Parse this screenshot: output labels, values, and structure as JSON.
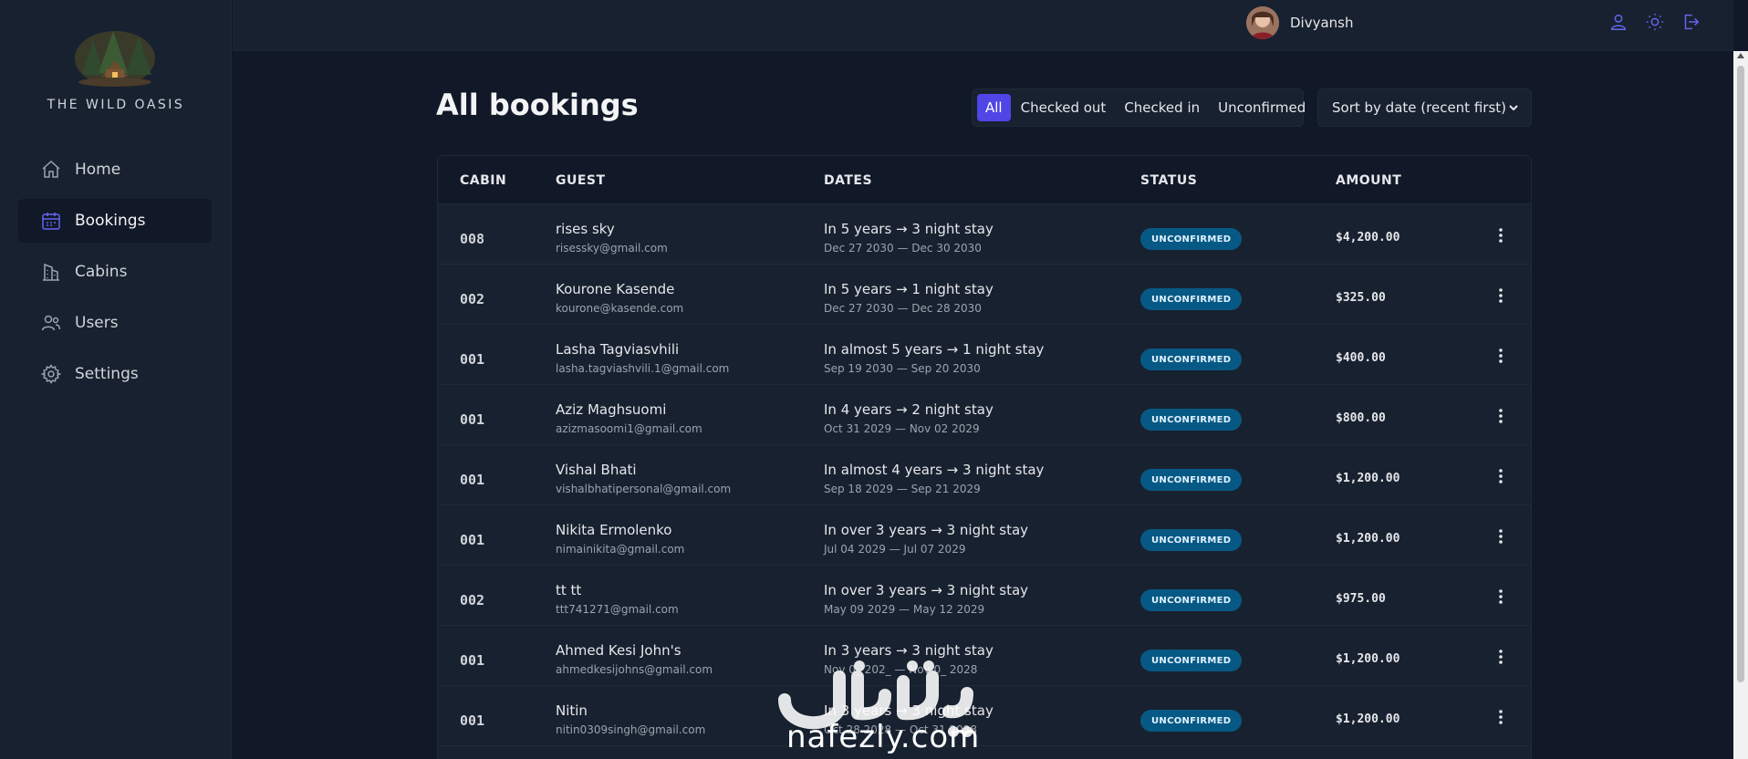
{
  "app": {
    "logo_text": "THE WILD OASIS"
  },
  "sidebar": {
    "items": [
      {
        "label": "Home",
        "icon": "home-icon",
        "active": false
      },
      {
        "label": "Bookings",
        "icon": "calendar-icon",
        "active": true
      },
      {
        "label": "Cabins",
        "icon": "building-icon",
        "active": false
      },
      {
        "label": "Users",
        "icon": "users-icon",
        "active": false
      },
      {
        "label": "Settings",
        "icon": "gear-icon",
        "active": false
      }
    ]
  },
  "header": {
    "username": "Divyansh",
    "icons": [
      "user-icon",
      "sun-icon",
      "logout-icon"
    ]
  },
  "page": {
    "title": "All bookings"
  },
  "filter": {
    "options": [
      "All",
      "Checked out",
      "Checked in",
      "Unconfirmed"
    ],
    "active": "All"
  },
  "sort": {
    "selected": "Sort by date (recent first)"
  },
  "table": {
    "columns": [
      "CABIN",
      "GUEST",
      "DATES",
      "STATUS",
      "AMOUNT"
    ],
    "rows": [
      {
        "cabin": "008",
        "name": "rises sky",
        "email": "risessky@gmail.com",
        "dates": "In 5 years → 3 night stay",
        "range": "Dec 27 2030 — Dec 30 2030",
        "status": "UNCONFIRMED",
        "amount": "$4,200.00"
      },
      {
        "cabin": "002",
        "name": "Kourone Kasende",
        "email": "kourone@kasende.com",
        "dates": "In 5 years → 1 night stay",
        "range": "Dec 27 2030 — Dec 28 2030",
        "status": "UNCONFIRMED",
        "amount": "$325.00"
      },
      {
        "cabin": "001",
        "name": "Lasha Tagviasvhili",
        "email": "lasha.tagviashvili.1@gmail.com",
        "dates": "In almost 5 years → 1 night stay",
        "range": "Sep 19 2030 — Sep 20 2030",
        "status": "UNCONFIRMED",
        "amount": "$400.00"
      },
      {
        "cabin": "001",
        "name": "Aziz Maghsuomi",
        "email": "azizmasoomi1@gmail.com",
        "dates": "In 4 years → 2 night stay",
        "range": "Oct 31 2029 — Nov 02 2029",
        "status": "UNCONFIRMED",
        "amount": "$800.00"
      },
      {
        "cabin": "001",
        "name": "Vishal Bhati",
        "email": "vishalbhatipersonal@gmail.com",
        "dates": "In almost 4 years → 3 night stay",
        "range": "Sep 18 2029 — Sep 21 2029",
        "status": "UNCONFIRMED",
        "amount": "$1,200.00"
      },
      {
        "cabin": "001",
        "name": "Nikita Ermolenko",
        "email": "nimainikita@gmail.com",
        "dates": "In over 3 years → 3 night stay",
        "range": "Jul 04 2029 — Jul 07 2029",
        "status": "UNCONFIRMED",
        "amount": "$1,200.00"
      },
      {
        "cabin": "002",
        "name": "tt tt",
        "email": "ttt741271@gmail.com",
        "dates": "In over 3 years → 3 night stay",
        "range": "May 09 2029 — May 12 2029",
        "status": "UNCONFIRMED",
        "amount": "$975.00"
      },
      {
        "cabin": "001",
        "name": "Ahmed Kesi John's",
        "email": "ahmedkesijohns@gmail.com",
        "dates": "In 3 years → 3 night stay",
        "range": "Nov 0_ 202_ — Nov 0_ 2028",
        "status": "UNCONFIRMED",
        "amount": "$1,200.00"
      },
      {
        "cabin": "001",
        "name": "Nitin",
        "email": "nitin0309singh@gmail.com",
        "dates": "In 3 years → 3 night stay",
        "range": "Oct 28 2028 — Oct 31 2028",
        "status": "UNCONFIRMED",
        "amount": "$1,200.00"
      }
    ]
  },
  "watermark": {
    "text": "nafezly.com"
  },
  "colors": {
    "background": "#111827",
    "sidebar": "#18212f",
    "accent": "#4f46e5",
    "status_badge": "#075985"
  }
}
